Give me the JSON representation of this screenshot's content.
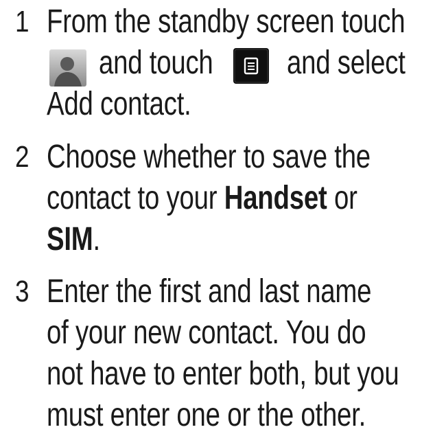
{
  "steps": [
    {
      "number": "1",
      "line1": "From the standby screen touch",
      "line2_and_touch": "and touch",
      "line2_and_select": "and select",
      "line3": "Add contact.",
      "icons": [
        "contact-icon",
        "menu-icon"
      ]
    },
    {
      "number": "2",
      "line1": "Choose whether to save the",
      "line2_pre": "contact to your ",
      "line2_bold": "Handset",
      "line2_post": " or",
      "line3_bold": "SIM",
      "line3_post": "."
    },
    {
      "number": "3",
      "line1": "Enter the first and last name",
      "line2": "of your new contact. You do",
      "line3": "not have to enter both, but you",
      "line4": "must enter one or the other."
    }
  ],
  "colors": {
    "text": "#1a1a1a",
    "menu_icon_bg": "#0f0f0f"
  }
}
